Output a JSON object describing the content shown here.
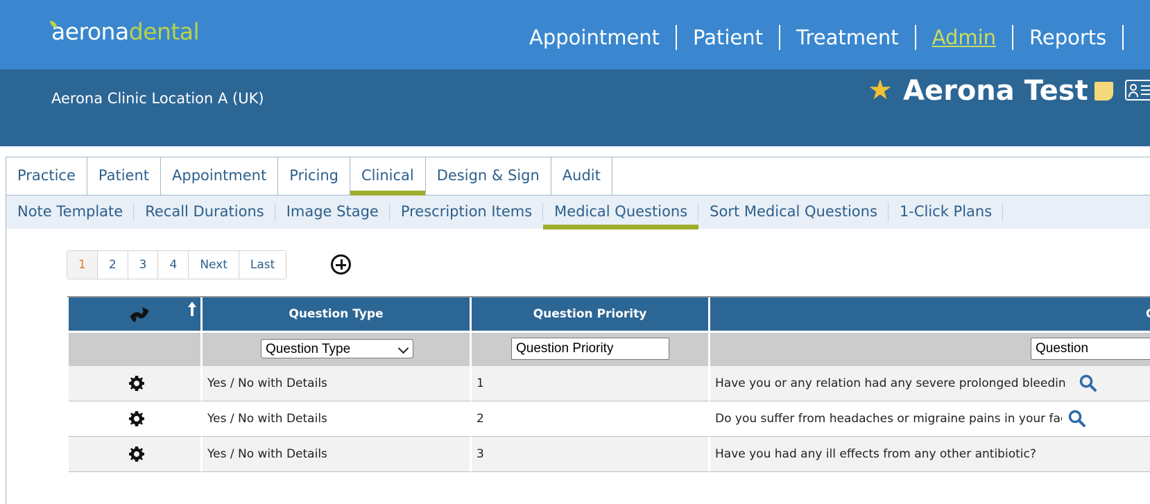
{
  "brand": {
    "logo_part1": "aerona",
    "logo_part2": "dental"
  },
  "main_nav": [
    {
      "label": "Appointment"
    },
    {
      "label": "Patient"
    },
    {
      "label": "Treatment"
    },
    {
      "label": "Admin",
      "active": true
    },
    {
      "label": "Reports"
    }
  ],
  "clinic": {
    "location": "Aerona Clinic Location A (UK)"
  },
  "patient": {
    "name": "Aerona Test",
    "star_icon": "star-icon"
  },
  "tabs": [
    "Practice",
    "Patient",
    "Appointment",
    "Pricing",
    "Clinical",
    "Design & Sign",
    "Audit"
  ],
  "active_tab": "Clinical",
  "subtabs": [
    "Note Template",
    "Recall Durations",
    "Image Stage",
    "Prescription Items",
    "Medical Questions",
    "Sort Medical Questions",
    "1-Click Plans"
  ],
  "active_subtab": "Medical Questions",
  "pager": {
    "pages": [
      "1",
      "2",
      "3",
      "4"
    ],
    "current": "1",
    "next": "Next",
    "last": "Last"
  },
  "table": {
    "headers": {
      "type": "Question Type",
      "priority": "Question Priority",
      "question": "Q"
    },
    "filters": {
      "type_select": "Question Type",
      "priority_input": "Question Priority",
      "question_input": "Question"
    },
    "rows": [
      {
        "type": "Yes / No with Details",
        "priority": "1",
        "question": "Have you or any relation had any severe prolonged bleeding p"
      },
      {
        "type": "Yes / No with Details",
        "priority": "2",
        "question": "Do you suffer from headaches or migraine pains in your face"
      },
      {
        "type": "Yes / No with Details",
        "priority": "3",
        "question": "Have you had any ill effects from any other antibiotic?"
      }
    ]
  },
  "colors": {
    "topbar": "#3a87cf",
    "clinicbar": "#2c6695",
    "accent": "#9fad2e",
    "active_nav": "#c9dc5c"
  }
}
